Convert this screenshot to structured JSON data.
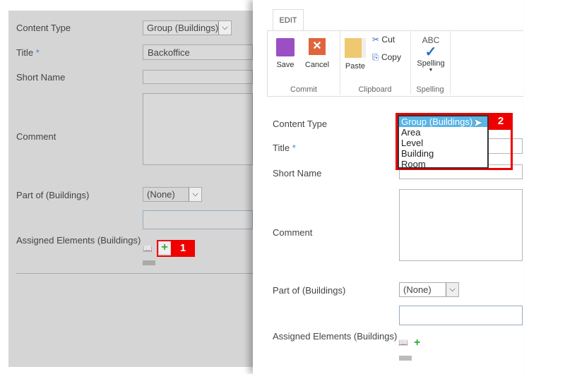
{
  "background_form": {
    "content_type_label": "Content Type",
    "content_type_value": "Group (Buildings)",
    "title_label": "Title",
    "required_mark": "*",
    "title_value": "Backoffice",
    "short_name_label": "Short Name",
    "comment_label": "Comment",
    "part_of_label": "Part of (Buildings)",
    "part_of_value": "(None)",
    "assigned_label": "Assigned Elements (Buildings)",
    "callout": "1"
  },
  "ribbon": {
    "tab": "EDIT",
    "save": "Save",
    "cancel": "Cancel",
    "paste": "Paste",
    "cut": "Cut",
    "copy": "Copy",
    "spelling_abc": "ABC",
    "spelling": "Spelling",
    "commit_group": "Commit",
    "clipboard_group": "Clipboard",
    "spelling_group": "Spelling"
  },
  "form": {
    "content_type_label": "Content Type",
    "title_label": "Title",
    "required_mark": "*",
    "short_name_label": "Short Name",
    "comment_label": "Comment",
    "part_of_label": "Part of (Buildings)",
    "part_of_value": "(None)",
    "assigned_label": "Assigned Elements (Buildings)",
    "dropdown_options": [
      "Group (Buildings)",
      "Area",
      "Level",
      "Building",
      "Room"
    ],
    "callout": "2"
  },
  "colors": {
    "highlight": "#5ab4e6",
    "callout": "#e00000",
    "panel": "#d5d5d5"
  }
}
